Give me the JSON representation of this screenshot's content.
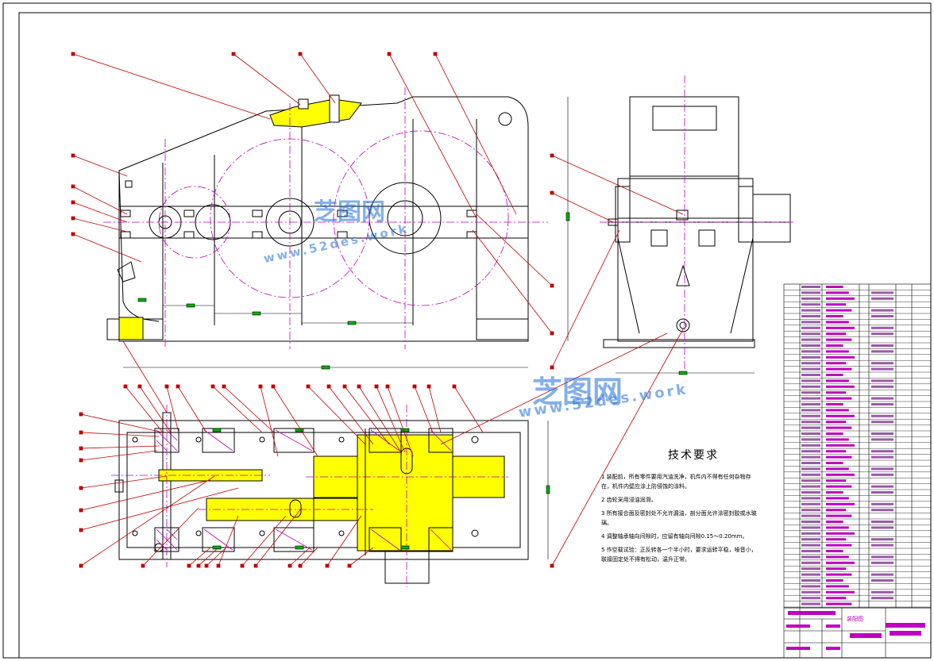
{
  "drawing": {
    "colors": {
      "outline": "#000000",
      "centerline": "#c000c0",
      "leader": "#c00000",
      "dimension": "#00b000",
      "section": "#ffff00"
    }
  },
  "technical_requirements": {
    "title": "技术要求",
    "items": [
      "1 装配前，所有零件要用汽油洗净，机件内不得有任何杂物存在，机件内壁应涂上防侵蚀的涂料。",
      "2 齿轮采用浸油润滑。",
      "3 所有接合面及密封处不允许漏油，剖分面允许涂密封胶或水玻璃。",
      "4 调整轴承轴向间隙时，应留有轴向间隙0.15～0.20mm。",
      "5 作空载试验：正反转各一个半小时，要求运转平稳，噪音小，联接固定处不得有松动，温升正常。"
    ]
  },
  "watermark": {
    "brand": "芝图网",
    "url": "www.52des.work"
  },
  "title_block": {
    "name": "装配图"
  }
}
